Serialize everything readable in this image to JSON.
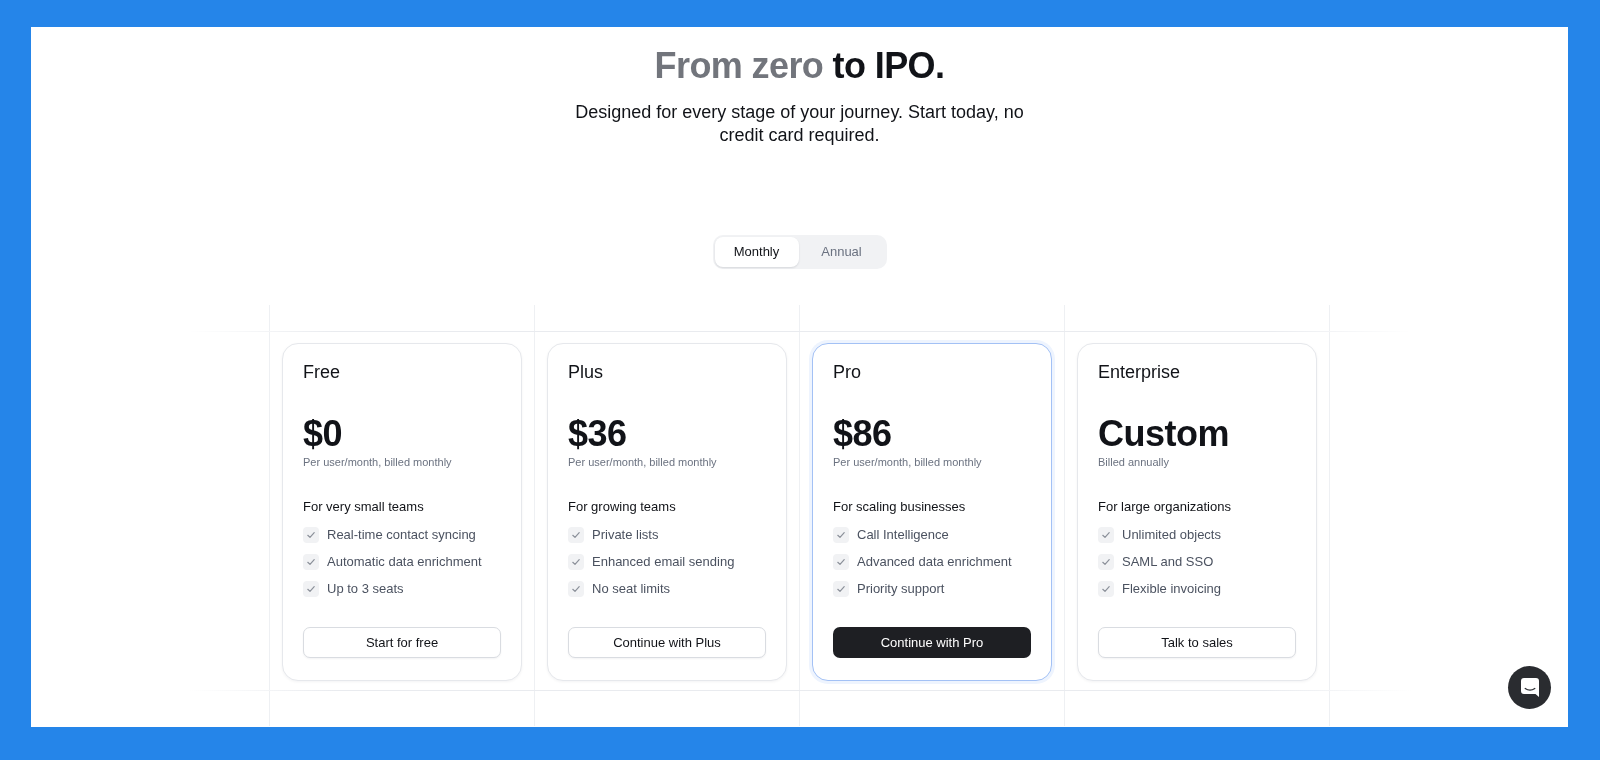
{
  "heading": {
    "muted": "From zero",
    "strong": "to IPO."
  },
  "subtitle": "Designed for every stage of your journey. Start today, no credit card required.",
  "billing_toggle": [
    {
      "label": "Monthly",
      "selected": true
    },
    {
      "label": "Annual",
      "selected": false
    }
  ],
  "plans": [
    {
      "name": "Free",
      "price": "$0",
      "price_note": "Per user/month, billed monthly",
      "audience": "For very small teams",
      "features": [
        "Real-time contact syncing",
        "Automatic data enrichment",
        "Up to 3 seats"
      ],
      "button": "Start for free",
      "featured": false
    },
    {
      "name": "Plus",
      "price": "$36",
      "price_note": "Per user/month, billed monthly",
      "audience": "For growing teams",
      "features": [
        "Private lists",
        "Enhanced email sending",
        "No seat limits"
      ],
      "button": "Continue with Plus",
      "featured": false
    },
    {
      "name": "Pro",
      "price": "$86",
      "price_note": "Per user/month, billed monthly",
      "audience": "For scaling businesses",
      "features": [
        "Call Intelligence",
        "Advanced data enrichment",
        "Priority support"
      ],
      "button": "Continue with Pro",
      "featured": true
    },
    {
      "name": "Enterprise",
      "price": "Custom",
      "price_note": "Billed annually",
      "audience": "For large organizations",
      "features": [
        "Unlimited objects",
        "SAML and SSO",
        "Flexible invoicing"
      ],
      "button": "Talk to sales",
      "featured": false
    }
  ]
}
